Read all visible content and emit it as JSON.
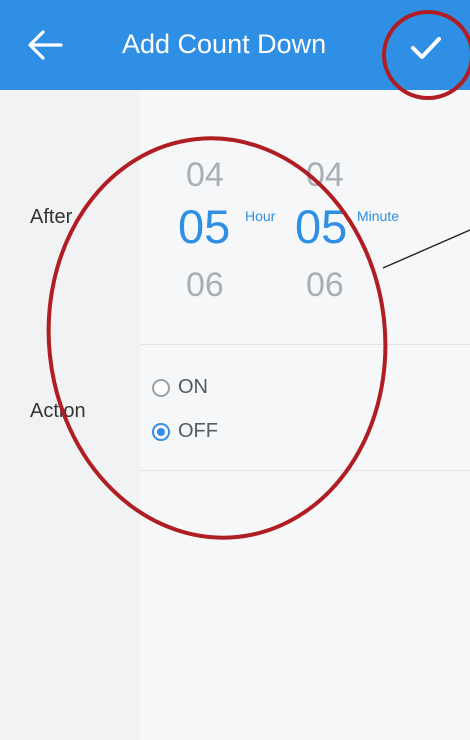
{
  "header": {
    "title": "Add Count Down",
    "back_icon": "arrow-left-icon",
    "confirm_icon": "checkmark-icon",
    "background_color": "#2f8fe4"
  },
  "after": {
    "label": "After",
    "hour": {
      "previous": "04",
      "selected": "05",
      "next": "06",
      "unit": "Hour"
    },
    "minute": {
      "previous": "04",
      "selected": "05",
      "next": "06",
      "unit": "Minute"
    }
  },
  "action": {
    "label": "Action",
    "options": [
      {
        "label": "ON",
        "checked": false
      },
      {
        "label": "OFF",
        "checked": true
      }
    ]
  },
  "annotations": {
    "color": "#b01e23"
  }
}
